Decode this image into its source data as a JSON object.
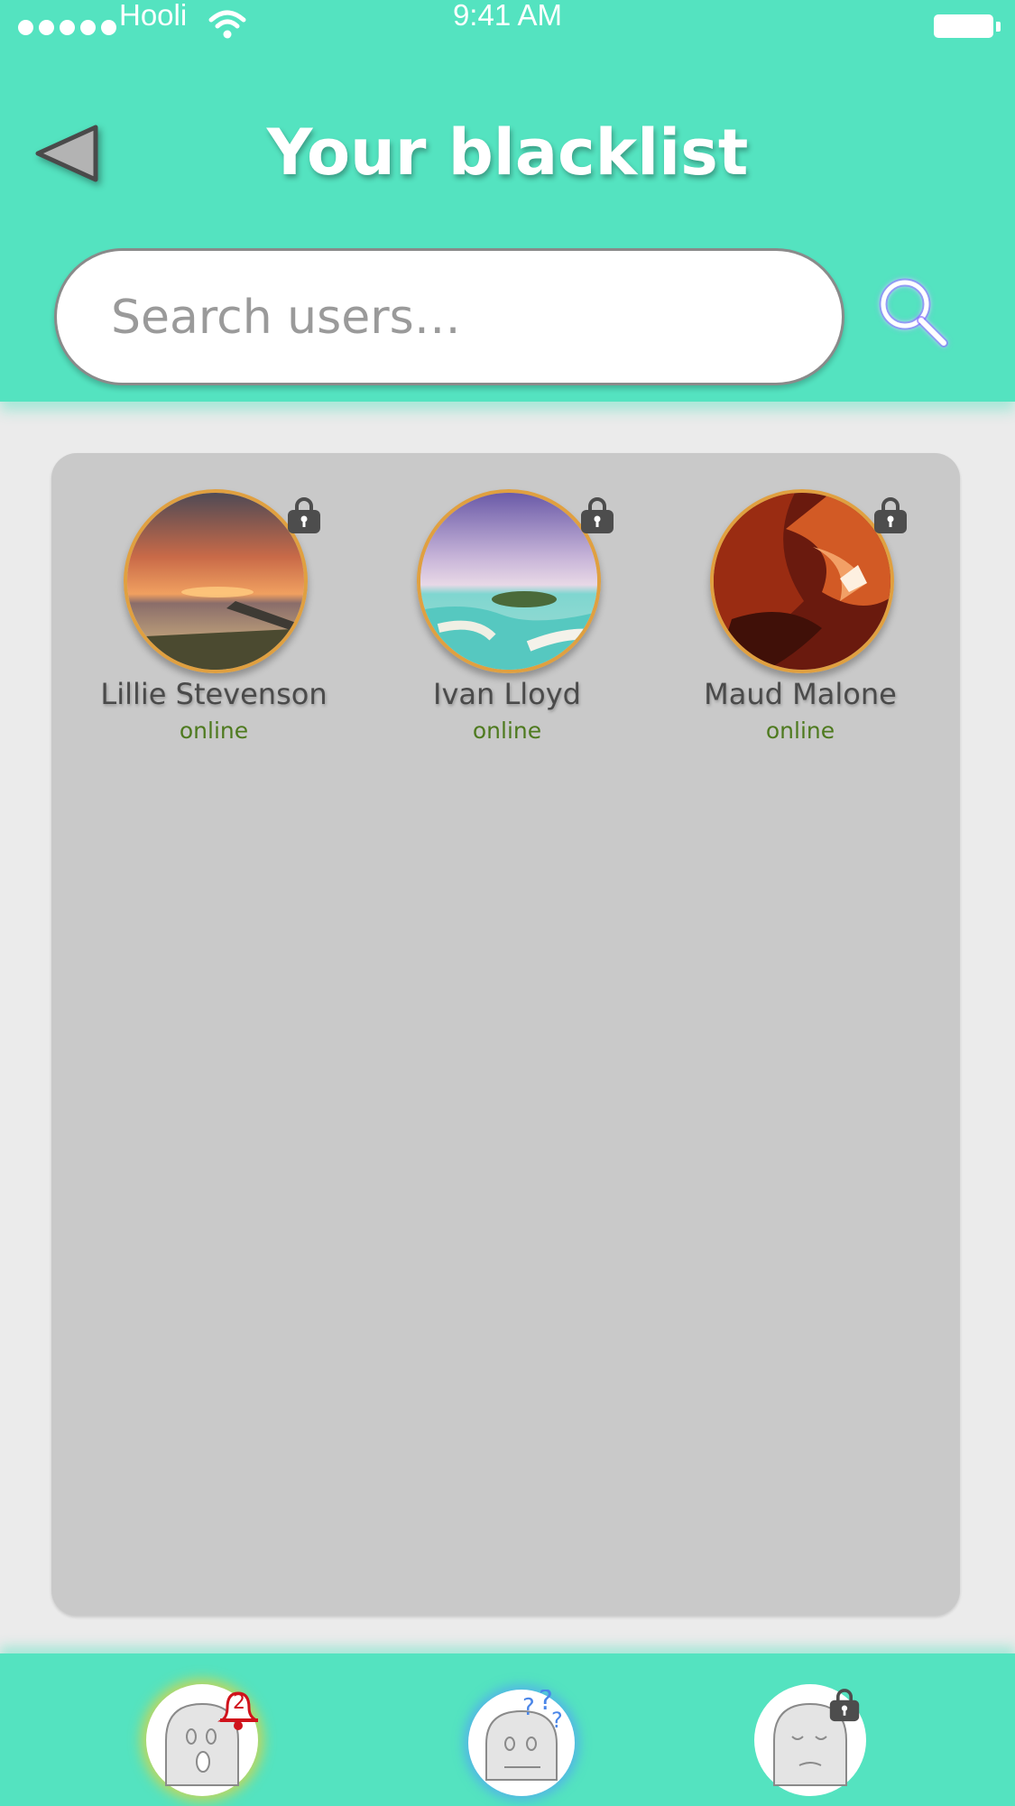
{
  "status_bar": {
    "carrier": "Hooli",
    "time": "9:41 AM"
  },
  "header": {
    "title": "Your blacklist"
  },
  "search": {
    "placeholder": "Search users…",
    "value": ""
  },
  "users": [
    {
      "name": "Lillie Stevenson",
      "status": "online",
      "photo": "sunset-beach"
    },
    {
      "name": "Ivan Lloyd",
      "status": "online",
      "photo": "tropical-island"
    },
    {
      "name": "Maud Malone",
      "status": "online",
      "photo": "red-canyon"
    }
  ],
  "tabbar": {
    "notifications_badge": "2",
    "tabs": [
      "alerts-ghost-icon",
      "questions-ghost-icon",
      "blacklist-ghost-icon"
    ]
  },
  "colors": {
    "accent": "#54e3c0",
    "online": "#4e7a1f",
    "avatar_ring": "#e0a040",
    "badge": "#d0121b"
  }
}
